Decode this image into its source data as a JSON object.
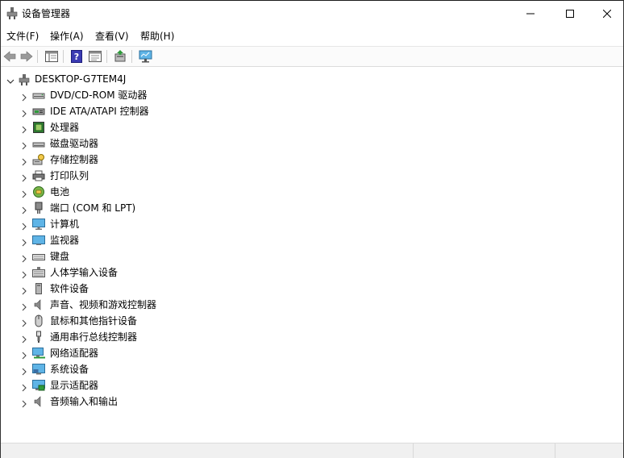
{
  "window": {
    "title": "设备管理器"
  },
  "menu": {
    "file": "文件(F)",
    "action": "操作(A)",
    "view": "查看(V)",
    "help": "帮助(H)"
  },
  "toolbar": {
    "icons": [
      "back-icon",
      "forward-icon",
      "show-hide-console-tree-icon",
      "help-icon",
      "properties-pane-icon",
      "update-driver-icon",
      "scan-hardware-icon"
    ]
  },
  "tree": {
    "root": "DESKTOP-G7TEM4J",
    "nodes": [
      {
        "label": "DVD/CD-ROM 驱动器",
        "icon": "dvd-drive-icon"
      },
      {
        "label": "IDE ATA/ATAPI 控制器",
        "icon": "ide-controller-icon"
      },
      {
        "label": "处理器",
        "icon": "processor-icon"
      },
      {
        "label": "磁盘驱动器",
        "icon": "disk-drive-icon"
      },
      {
        "label": "存储控制器",
        "icon": "storage-controller-icon"
      },
      {
        "label": "打印队列",
        "icon": "printer-icon"
      },
      {
        "label": "电池",
        "icon": "battery-icon"
      },
      {
        "label": "端口 (COM 和 LPT)",
        "icon": "port-icon"
      },
      {
        "label": "计算机",
        "icon": "computer-icon"
      },
      {
        "label": "监视器",
        "icon": "monitor-icon"
      },
      {
        "label": "键盘",
        "icon": "keyboard-icon"
      },
      {
        "label": "人体学输入设备",
        "icon": "hid-icon"
      },
      {
        "label": "软件设备",
        "icon": "software-device-icon"
      },
      {
        "label": "声音、视频和游戏控制器",
        "icon": "sound-icon"
      },
      {
        "label": "鼠标和其他指针设备",
        "icon": "mouse-icon"
      },
      {
        "label": "通用串行总线控制器",
        "icon": "usb-icon"
      },
      {
        "label": "网络适配器",
        "icon": "network-adapter-icon"
      },
      {
        "label": "系统设备",
        "icon": "system-device-icon"
      },
      {
        "label": "显示适配器",
        "icon": "display-adapter-icon"
      },
      {
        "label": "音频输入和输出",
        "icon": "audio-io-icon"
      }
    ]
  },
  "colors": {
    "border": "#333333",
    "toolbar_bg": "#fbfbfb",
    "statusbar_bg": "#f0f0f0"
  }
}
